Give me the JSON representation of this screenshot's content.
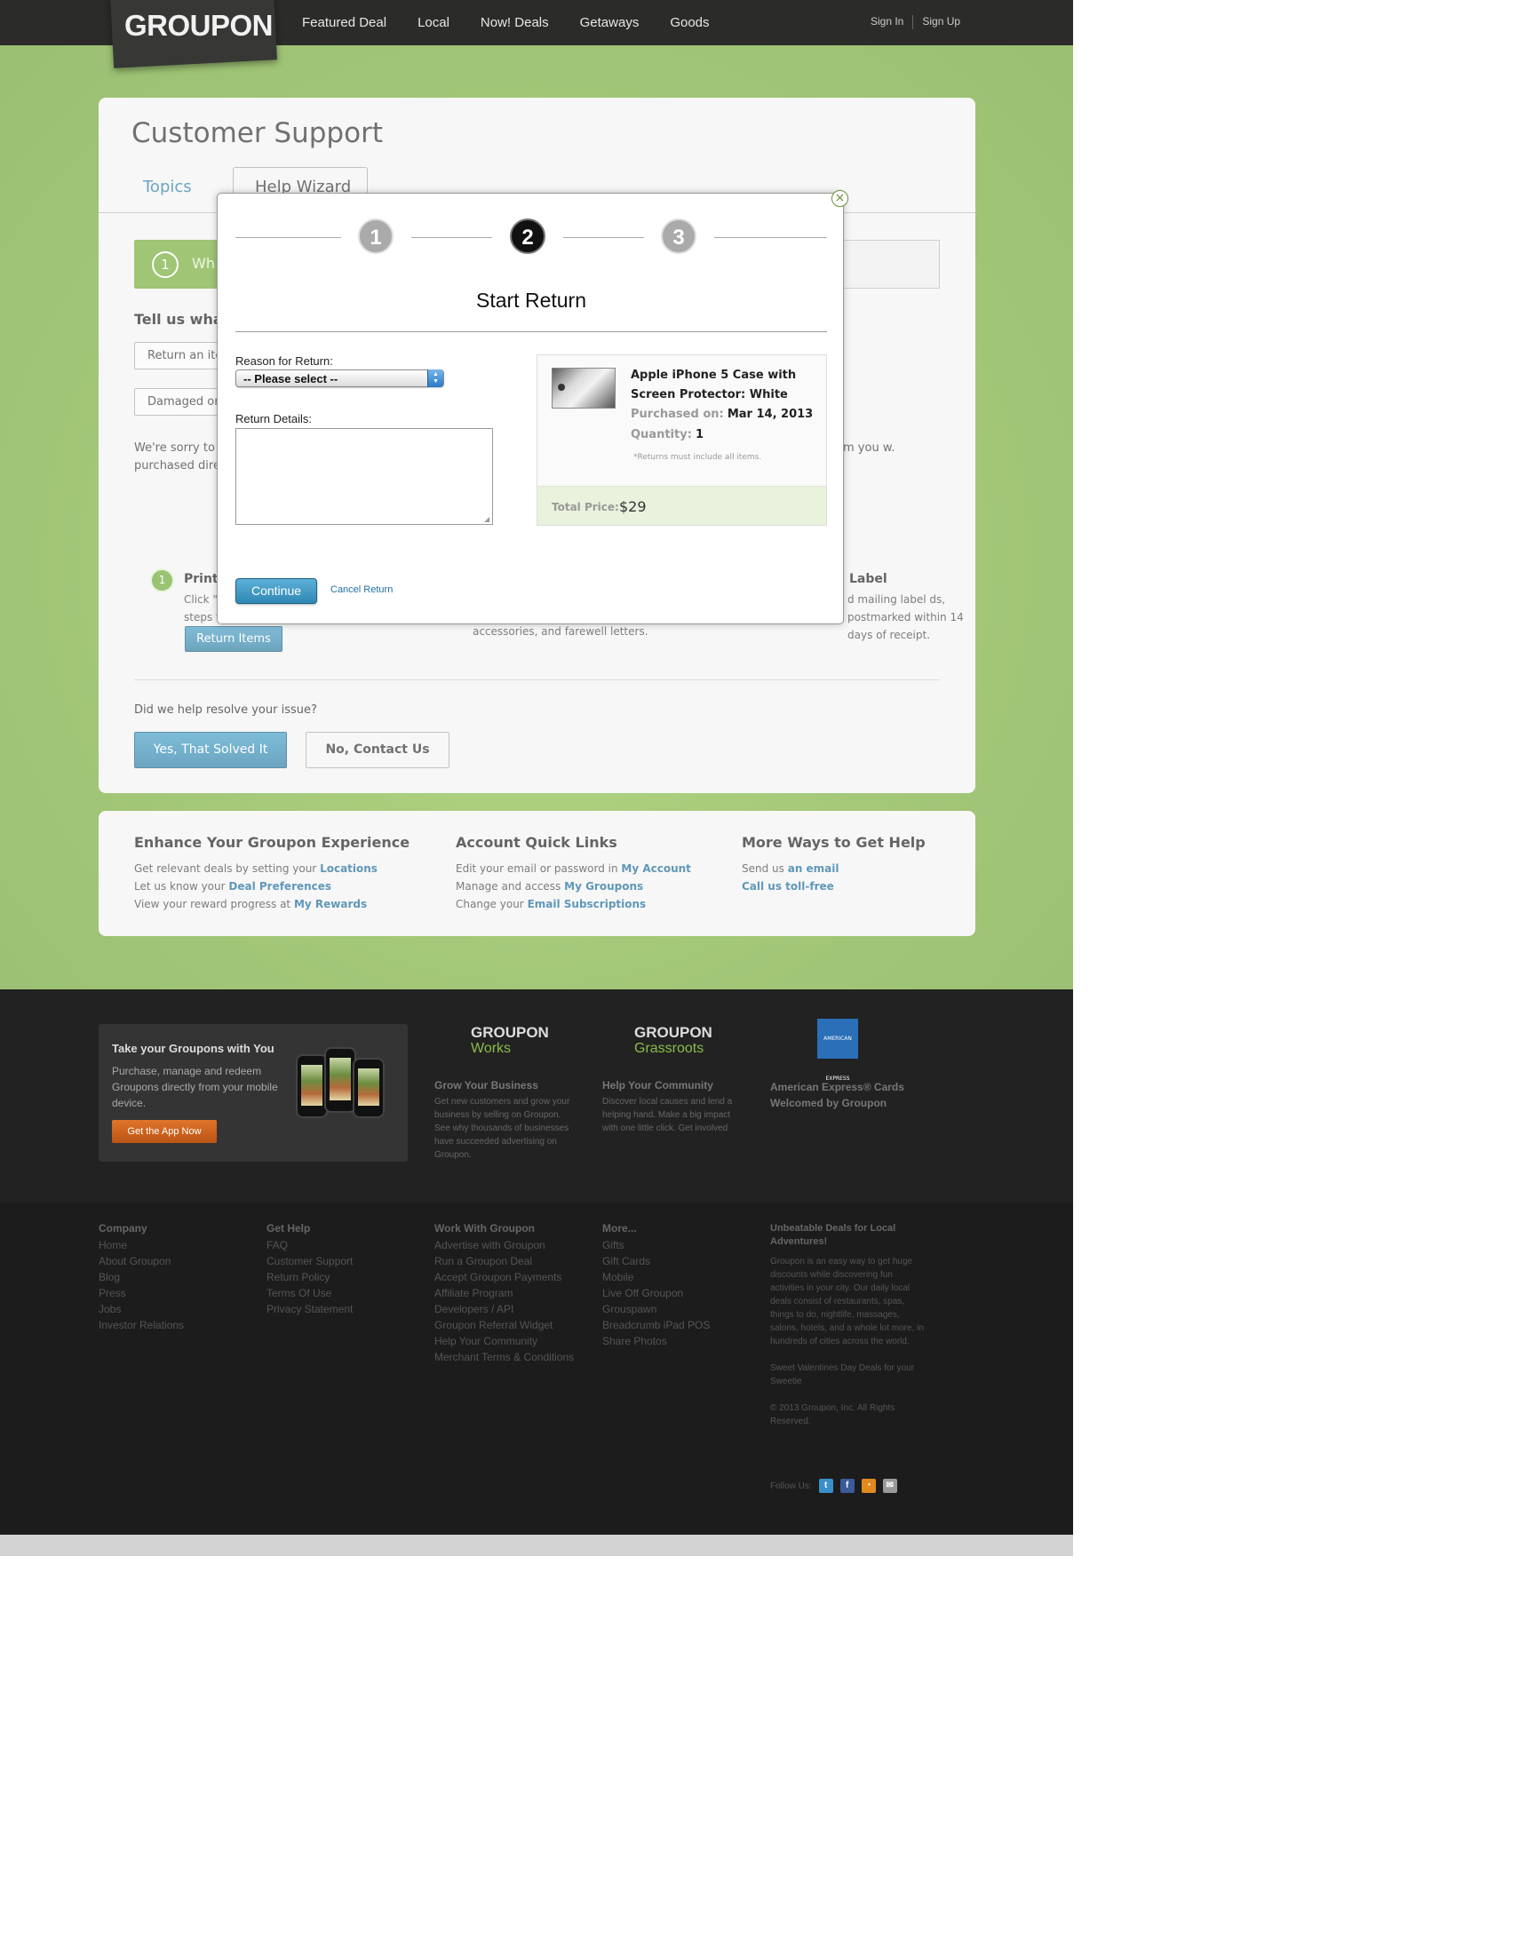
{
  "header": {
    "logo": "GROUPON",
    "nav": [
      "Featured Deal",
      "Local",
      "Now! Deals",
      "Getaways",
      "Goods"
    ],
    "sign_in": "Sign In",
    "sign_up": "Sign Up"
  },
  "support": {
    "title": "Customer Support",
    "tabs": {
      "topics": "Topics",
      "help_wizard": "Help Wizard"
    },
    "step_number": "1",
    "step_text": "Wh",
    "tell_us": "Tell us what",
    "choices": [
      "Return an ite",
      "Damaged or"
    ],
    "sorry_left": "We're sorry to l purchased dire",
    "sorry_right": "em you w.",
    "col1": {
      "badge": "1",
      "title": "Print",
      "text_line1": "Click \"",
      "text_line2": "steps t",
      "button": "Return Items"
    },
    "col2_text": "accessories, and farewell letters.",
    "col3": {
      "title": "Label",
      "text": "d mailing label ds, postmarked within 14 days of receipt."
    },
    "resolve_question": "Did we help resolve your issue?",
    "yes_button": "Yes, That Solved It",
    "no_button": "No, Contact Us"
  },
  "quick_links": {
    "enhance": {
      "title": "Enhance Your Groupon Experience",
      "lines": [
        {
          "text": "Get relevant deals by setting your ",
          "link": "Locations"
        },
        {
          "text": "Let us know your ",
          "link": "Deal Preferences"
        },
        {
          "text": "View your reward progress at ",
          "link": "My Rewards"
        }
      ]
    },
    "account": {
      "title": "Account Quick Links",
      "lines": [
        {
          "text": "Edit your email or password in ",
          "link": "My Account"
        },
        {
          "text": "Manage and access ",
          "link": "My Groupons"
        },
        {
          "text": "Change your ",
          "link": "Email Subscriptions"
        }
      ]
    },
    "more_help": {
      "title": "More Ways to Get Help",
      "lines": [
        {
          "text": "Send us ",
          "link": "an email"
        },
        {
          "text": "",
          "link": "Call us toll-free"
        }
      ]
    }
  },
  "modal": {
    "steps": [
      "1",
      "2",
      "3"
    ],
    "active_step": 2,
    "title": "Start Return",
    "reason_label": "Reason for Return:",
    "reason_selected": "-- Please select --",
    "details_label": "Return Details:",
    "details_value": "",
    "product": {
      "name": "Apple iPhone 5 Case with Screen Protector: White",
      "purchased_label": "Purchased on:",
      "purchased_value": "Mar 14, 2013",
      "quantity_label": "Quantity:",
      "quantity_value": "1",
      "note": "*Returns must include all items.",
      "total_label": "Total Price:",
      "total_value": "$29"
    },
    "continue_button": "Continue",
    "cancel_link": "Cancel Return"
  },
  "promo": {
    "app_title": "Take your Groupons with You",
    "app_desc": "Purchase, manage and redeem Groupons directly from your mobile device.",
    "app_button": "Get the App Now",
    "works_brand": "GROUPON",
    "works_sub": "Works",
    "grassroots_brand": "GROUPON",
    "grassroots_sub": "Grassroots",
    "amex_logo": "AMERICAN EXPRESS",
    "grow_title": "Grow Your Business",
    "grow_text": "Get new customers and grow your business by selling on Groupon. See why thousands of businesses have succeeded advertising on Groupon.",
    "community_title": "Help Your Community",
    "community_text": "Discover local causes and lend a helping hand. Make a big impact with one little click. Get involved",
    "amex_title": "American Express® Cards Welcomed by Groupon"
  },
  "footer": {
    "company": {
      "title": "Company",
      "items": [
        "Home",
        "About Groupon",
        "Blog",
        "Press",
        "Jobs",
        "Investor Relations"
      ]
    },
    "help": {
      "title": "Get Help",
      "items": [
        "FAQ",
        "Customer Support",
        "Return Policy",
        "Terms Of Use",
        "Privacy Statement"
      ]
    },
    "work": {
      "title": "Work With Groupon",
      "items": [
        "Advertise with Groupon",
        "Run a Groupon Deal",
        "Accept Groupon Payments",
        "Affiliate Program",
        "Developers / API",
        "Groupon Referral Widget",
        "Help Your Community",
        "Merchant Terms & Conditions"
      ]
    },
    "more": {
      "title": "More...",
      "items": [
        "Gifts",
        "Gift Cards",
        "Mobile",
        "Live Off Groupon",
        "Grouspawn",
        "Breadcrumb iPad POS",
        "Share Photos"
      ]
    },
    "about_title": "Unbeatable Deals for Local Adventures!",
    "about_text": "Groupon is an easy way to get huge discounts while discovering fun activities in your city. Our daily local deals consist of restaurants, spas, things to do, nightlife, massages, salons, hotels, and a whole lot more, in hundreds of cities across the world.",
    "valentines": "Sweet Valentines Day Deals for your Sweetie",
    "copyright": "© 2013 Groupon, Inc. All Rights Reserved.",
    "follow_us": "Follow Us:",
    "social": [
      "twitter-icon",
      "facebook-icon",
      "rss-icon",
      "email-icon"
    ]
  },
  "colors": {
    "brand_green": "#7cb03e",
    "header_dark": "#2b2b2a",
    "button_blue": "#2f87b3",
    "app_orange": "#e0742a"
  }
}
